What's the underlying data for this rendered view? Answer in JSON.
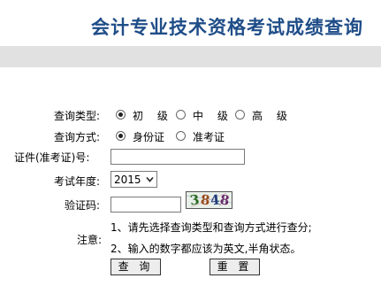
{
  "page": {
    "title": "会计专业技术资格考试成绩查询"
  },
  "form": {
    "query_type": {
      "label": "查询类型:",
      "options": [
        "初 级",
        "中 级",
        "高 级"
      ],
      "selected": "初 级"
    },
    "query_method": {
      "label": "查询方式:",
      "options": [
        "身份证",
        "准考证"
      ],
      "selected": "身份证"
    },
    "id_number": {
      "label": "证件(准考证)号:",
      "value": ""
    },
    "exam_year": {
      "label": "考试年度:",
      "value": "2015"
    },
    "captcha": {
      "label": "验证码:",
      "value": "",
      "image_text": [
        "3",
        "8",
        "4",
        "8"
      ]
    },
    "notes": {
      "label": "注意:",
      "items": [
        "1、请先选择查询类型和查询方式进行查分;",
        "2、输入的数字都应该为英文,半角状态。"
      ]
    },
    "buttons": {
      "query": "查 询",
      "reset": "重 置"
    }
  }
}
